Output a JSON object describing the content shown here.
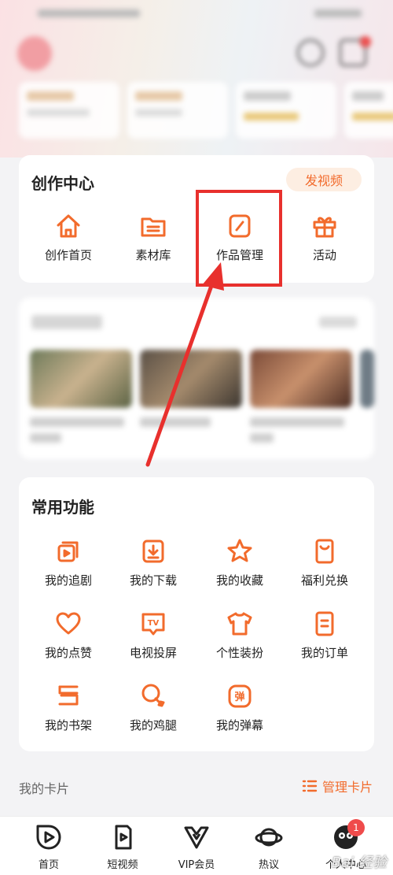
{
  "creation_center": {
    "title": "创作中心",
    "publish_button": "发视频",
    "items": [
      {
        "label": "创作首页",
        "icon": "home-icon"
      },
      {
        "label": "素材库",
        "icon": "folder-icon"
      },
      {
        "label": "作品管理",
        "icon": "edit-icon"
      },
      {
        "label": "活动",
        "icon": "gift-icon"
      }
    ]
  },
  "common_functions": {
    "title": "常用功能",
    "items": [
      {
        "label": "我的追剧",
        "icon": "play-stack-icon"
      },
      {
        "label": "我的下载",
        "icon": "download-icon"
      },
      {
        "label": "我的收藏",
        "icon": "star-icon"
      },
      {
        "label": "福利兑换",
        "icon": "coupon-icon"
      },
      {
        "label": "我的点赞",
        "icon": "heart-icon"
      },
      {
        "label": "电视投屏",
        "icon": "tv-cast-icon"
      },
      {
        "label": "个性装扮",
        "icon": "tshirt-icon"
      },
      {
        "label": "我的订单",
        "icon": "order-icon"
      },
      {
        "label": "我的书架",
        "icon": "bookshelf-icon"
      },
      {
        "label": "我的鸡腿",
        "icon": "drumstick-icon"
      },
      {
        "label": "我的弹幕",
        "icon": "danmaku-icon"
      }
    ],
    "danmaku_glyph": "弹",
    "tv_glyph": "TV"
  },
  "my_cards": {
    "label": "我的卡片",
    "manage": "管理卡片"
  },
  "tabbar": {
    "items": [
      {
        "label": "首页",
        "icon": "play-circle-icon"
      },
      {
        "label": "短视频",
        "icon": "short-video-icon"
      },
      {
        "label": "VIP会员",
        "icon": "vip-crown-icon"
      },
      {
        "label": "热议",
        "icon": "planet-icon"
      },
      {
        "label": "个人中心",
        "icon": "profile-avatar-icon"
      }
    ],
    "badge_count": "1"
  },
  "watermark": "Bai 经验",
  "colors": {
    "accent": "#f26b2c",
    "annotation": "#e8302d",
    "badge": "#ef4b4b"
  }
}
